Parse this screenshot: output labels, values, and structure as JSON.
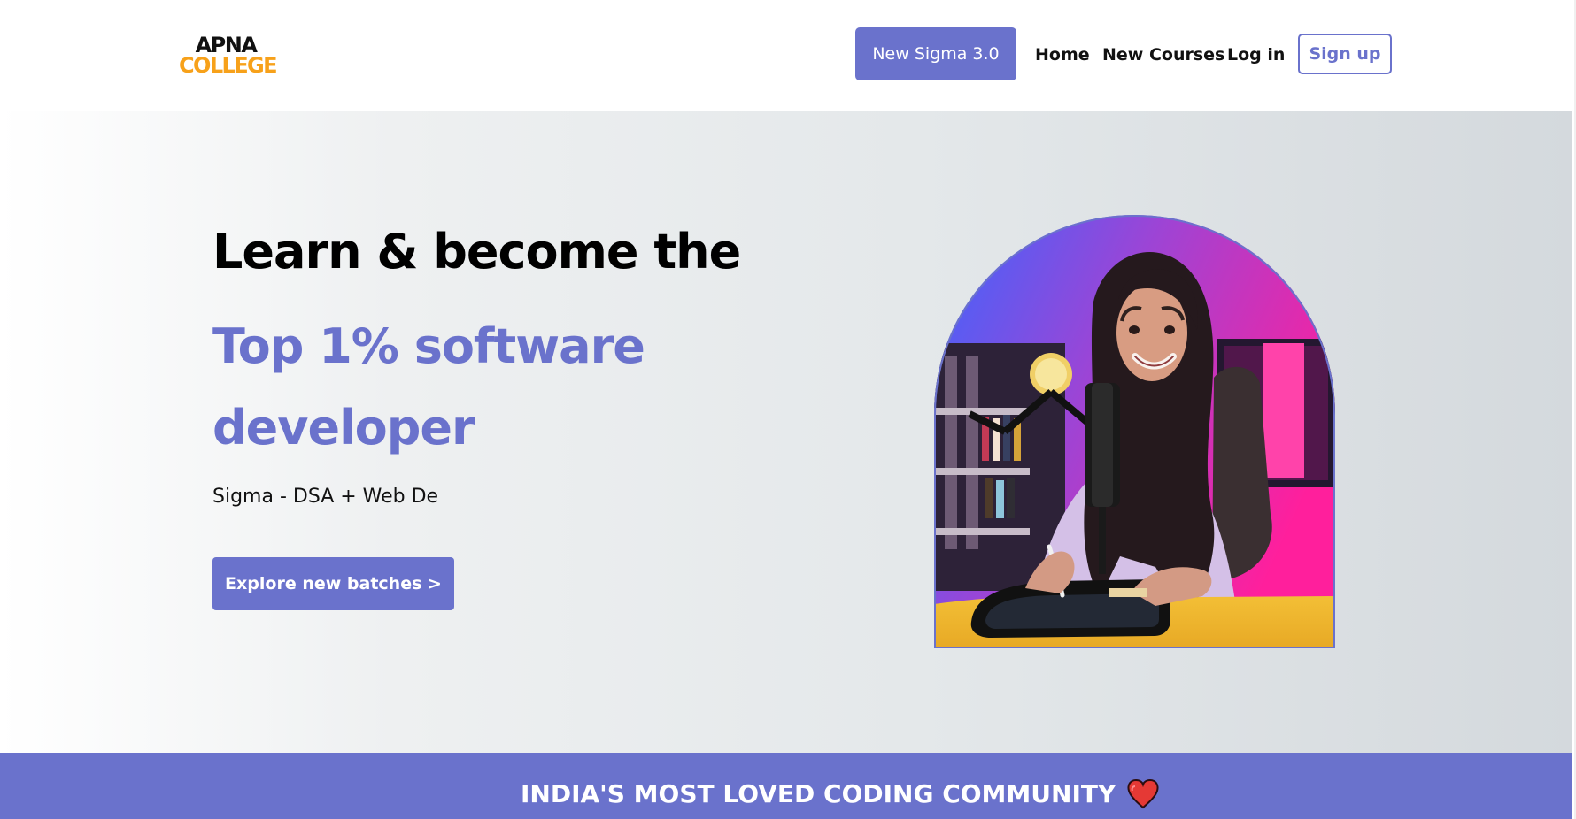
{
  "logo": {
    "top": "APNA",
    "bottom": "COLLEGE"
  },
  "header": {
    "cta_label": "New Sigma 3.0",
    "nav": [
      {
        "label": "Home"
      },
      {
        "label": "New Courses"
      },
      {
        "label": "Log in"
      }
    ],
    "signup_label": "Sign up"
  },
  "hero": {
    "title": "Learn & become the",
    "highlight": "Top 1% software developer",
    "subtitle": "Sigma - DSA + Web De",
    "button_label": "Explore new batches >"
  },
  "banner": {
    "text": "INDIA'S MOST LOVED CODING COMMUNITY",
    "icon": "heart-icon"
  },
  "colors": {
    "accent": "#6a72cc",
    "logo_orange": "#f7a11a",
    "hero_bg_right": "#d4d9dd"
  },
  "icons": {
    "banner": "heart-icon",
    "hero_image": "instructor-portrait"
  }
}
